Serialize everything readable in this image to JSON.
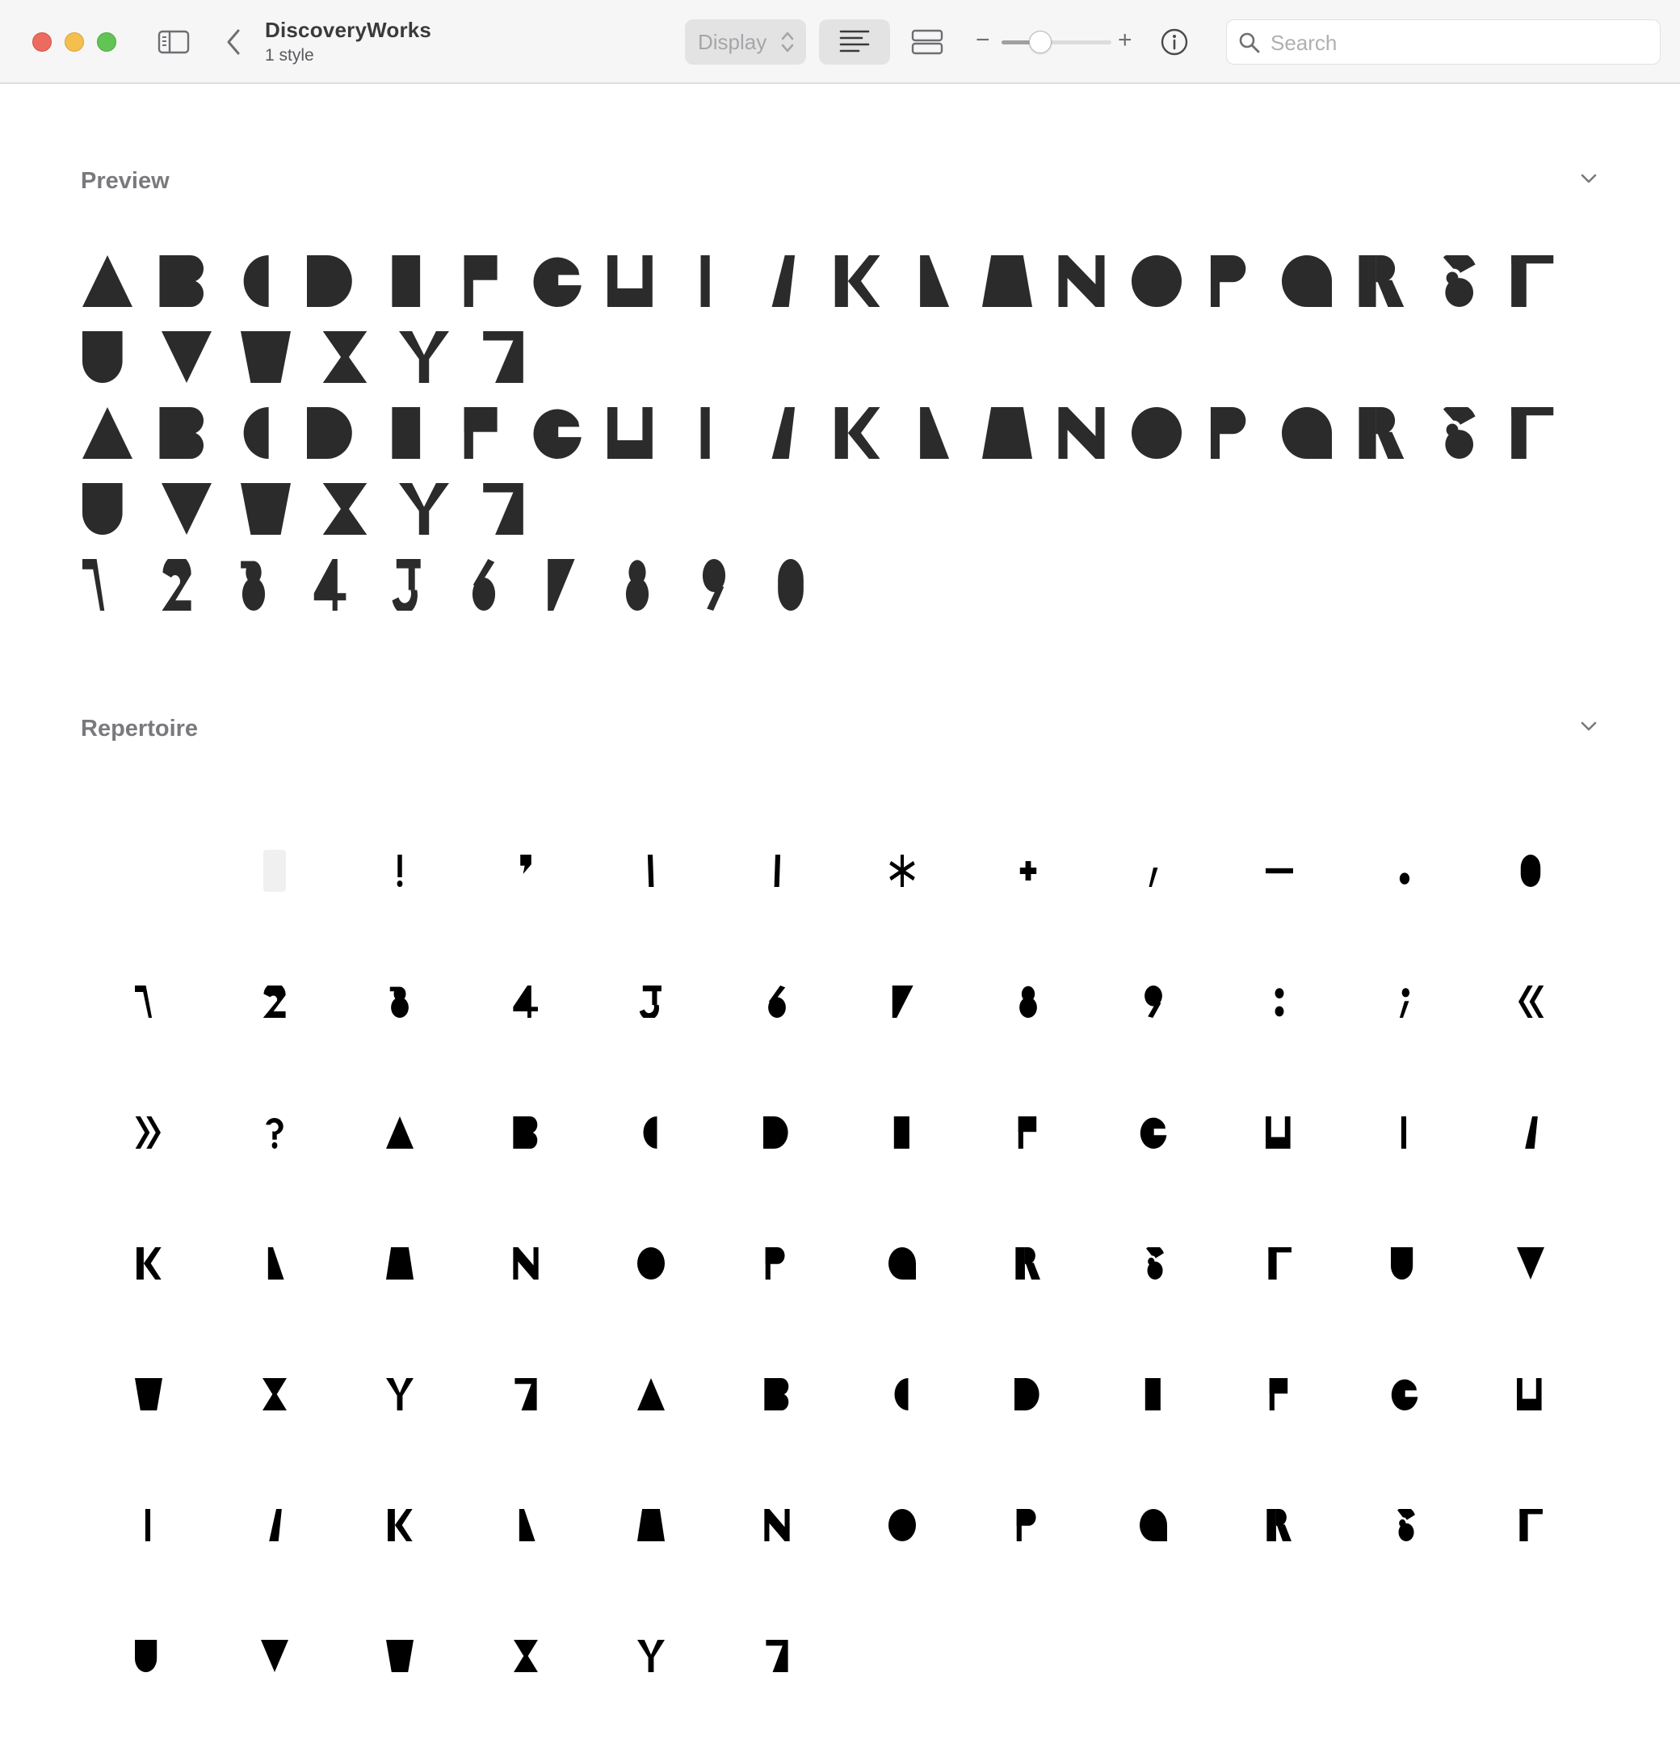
{
  "window": {
    "title": "DiscoveryWorks",
    "subtitle": "1 style"
  },
  "toolbar": {
    "display_select": {
      "selected": "Display"
    },
    "size_slider": {
      "value": 0.35
    },
    "minus_label": "−",
    "plus_label": "+",
    "search": {
      "placeholder": "Search",
      "value": ""
    }
  },
  "preview": {
    "title": "Preview",
    "lines": [
      [
        "A",
        "B",
        "C",
        "D",
        "E",
        "F",
        "G",
        "H",
        "I",
        "J",
        "K",
        "L",
        "M",
        "N",
        "O",
        "P",
        "Q",
        "R",
        "S",
        "T"
      ],
      [
        "U",
        "V",
        "W",
        "X",
        "Y",
        "Z"
      ],
      [
        "a",
        "b",
        "c",
        "d",
        "e",
        "f",
        "g",
        "h",
        "i",
        "j",
        "k",
        "l",
        "m",
        "n",
        "o",
        "p",
        "q",
        "r",
        "s",
        "t"
      ],
      [
        "u",
        "v",
        "w",
        "x",
        "y",
        "z"
      ],
      [
        "1",
        "2",
        "3",
        "4",
        "5",
        "6",
        "7",
        "8",
        "9",
        "0"
      ]
    ]
  },
  "repertoire": {
    "title": "Repertoire",
    "glyphs": [
      " ",
      "!",
      "'",
      "(",
      ")",
      "*",
      "+",
      ",",
      "-",
      ".",
      "0",
      "1",
      "2",
      "3",
      "4",
      "5",
      "6",
      "7",
      "8",
      "9",
      ":",
      ";",
      "«",
      "»",
      "?",
      "A",
      "B",
      "C",
      "D",
      "E",
      "F",
      "G",
      "H",
      "I",
      "J",
      "K",
      "L",
      "M",
      "N",
      "O",
      "P",
      "Q",
      "R",
      "S",
      "T",
      "U",
      "V",
      "W",
      "X",
      "Y",
      "Z",
      "a",
      "b",
      "c",
      "d",
      "e",
      "f",
      "g",
      "h",
      "i",
      "j",
      "k",
      "l",
      "m",
      "n",
      "o",
      "p",
      "q",
      "r",
      "s",
      "t",
      "u",
      "v",
      "w",
      "x",
      "y",
      "z"
    ]
  },
  "colors": {
    "glyph_preview": "#2b2b2b",
    "glyph_repertoire": "#000000",
    "close": "#ed6a5e",
    "minimize": "#f5bf4f",
    "zoom": "#61c454"
  },
  "icons": [
    "sidebar-toggle-icon",
    "back-chevron-icon",
    "updown-chevron-icon",
    "align-left-icon",
    "rows-icon",
    "info-icon",
    "search-icon",
    "chevron-down-icon"
  ]
}
